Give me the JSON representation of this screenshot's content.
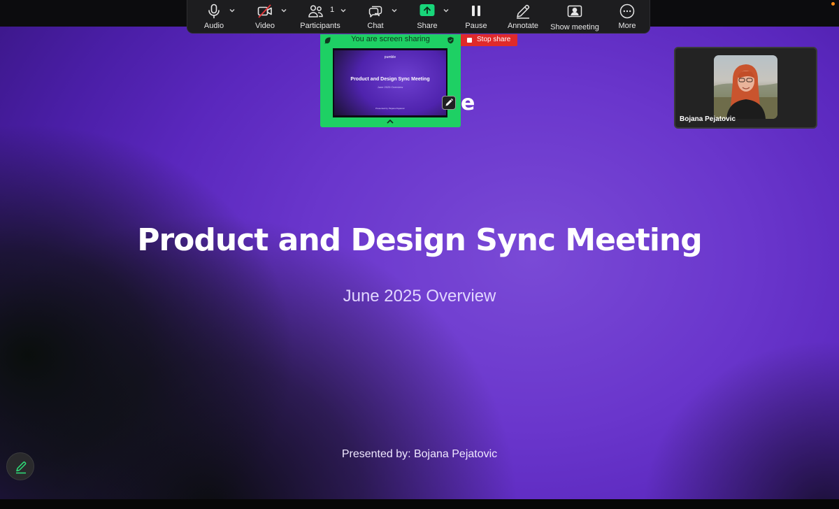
{
  "toolbar": {
    "audio_label": "Audio",
    "video_label": "Video",
    "participants_label": "Participants",
    "participants_count": "1",
    "chat_label": "Chat",
    "share_label": "Share",
    "pause_label": "Pause",
    "annotate_label": "Annotate",
    "show_meeting_label": "Show meeting",
    "more_label": "More"
  },
  "share_panel": {
    "status_text": "You are screen sharing",
    "preview": {
      "logo_text": "pumble",
      "title": "Product and Design Sync Meeting",
      "subtitle": "June 2025 Overview",
      "presenter": "Presented by: Bojana Pejatovic"
    }
  },
  "stop_share_label": "Stop share",
  "participant": {
    "name": "Bojana Pejatovic"
  },
  "slide": {
    "title": "Product and Design Sync Meeting",
    "subtitle": "June 2025 Overview",
    "presenter": "Presented by: Bojana Pejatovic",
    "partial_glyph": "e"
  },
  "colors": {
    "share_green": "#1ed064",
    "stop_red": "#e02a2a",
    "toolbar_bg": "#1d1d1f",
    "slide_purple": "#6a36cc",
    "record_dot": "#ff8c1a"
  },
  "icons": {
    "audio": "microphone-icon",
    "video": "video-off-icon",
    "participants": "people-icon",
    "chat": "chat-bubbles-icon",
    "share": "share-up-arrow-icon",
    "pause": "pause-icon",
    "annotate": "pencil-icon",
    "show_meeting": "person-frame-icon",
    "more": "more-dots-icon"
  }
}
